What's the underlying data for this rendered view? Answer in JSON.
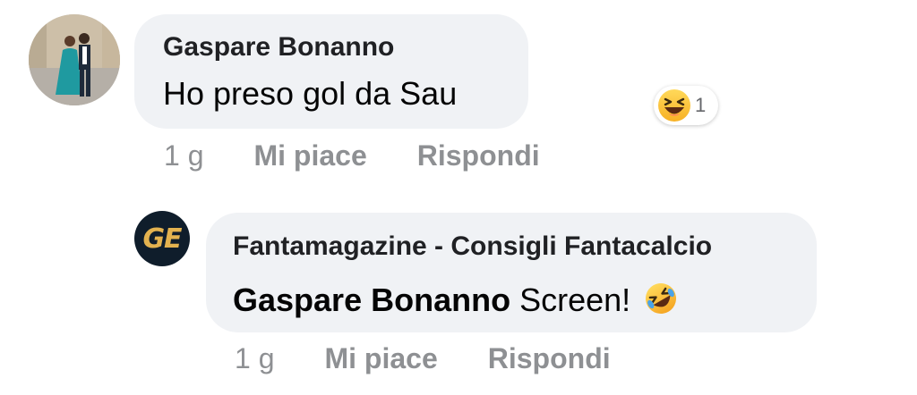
{
  "comment": {
    "author": "Gaspare Bonanno",
    "text": "Ho preso gol da Sau",
    "reaction": {
      "icon": "laughing-squint-face-icon",
      "count": "1"
    },
    "time": "1 g",
    "like_label": "Mi piace",
    "reply_label": "Rispondi"
  },
  "reply": {
    "avatar_text": "GE",
    "author": "Fantamagazine - Consigli Fantacalcio",
    "mention": "Gaspare Bonanno",
    "text": "Screen!",
    "emoji": "rofl-emoji-icon",
    "time": "1 g",
    "like_label": "Mi piace",
    "reply_label": "Rispondi"
  },
  "colors": {
    "bubble": "#f0f2f5",
    "meta": "#8e9093",
    "page_avatar_bg": "#0f1d2b",
    "page_avatar_text": "#e3b24f"
  }
}
